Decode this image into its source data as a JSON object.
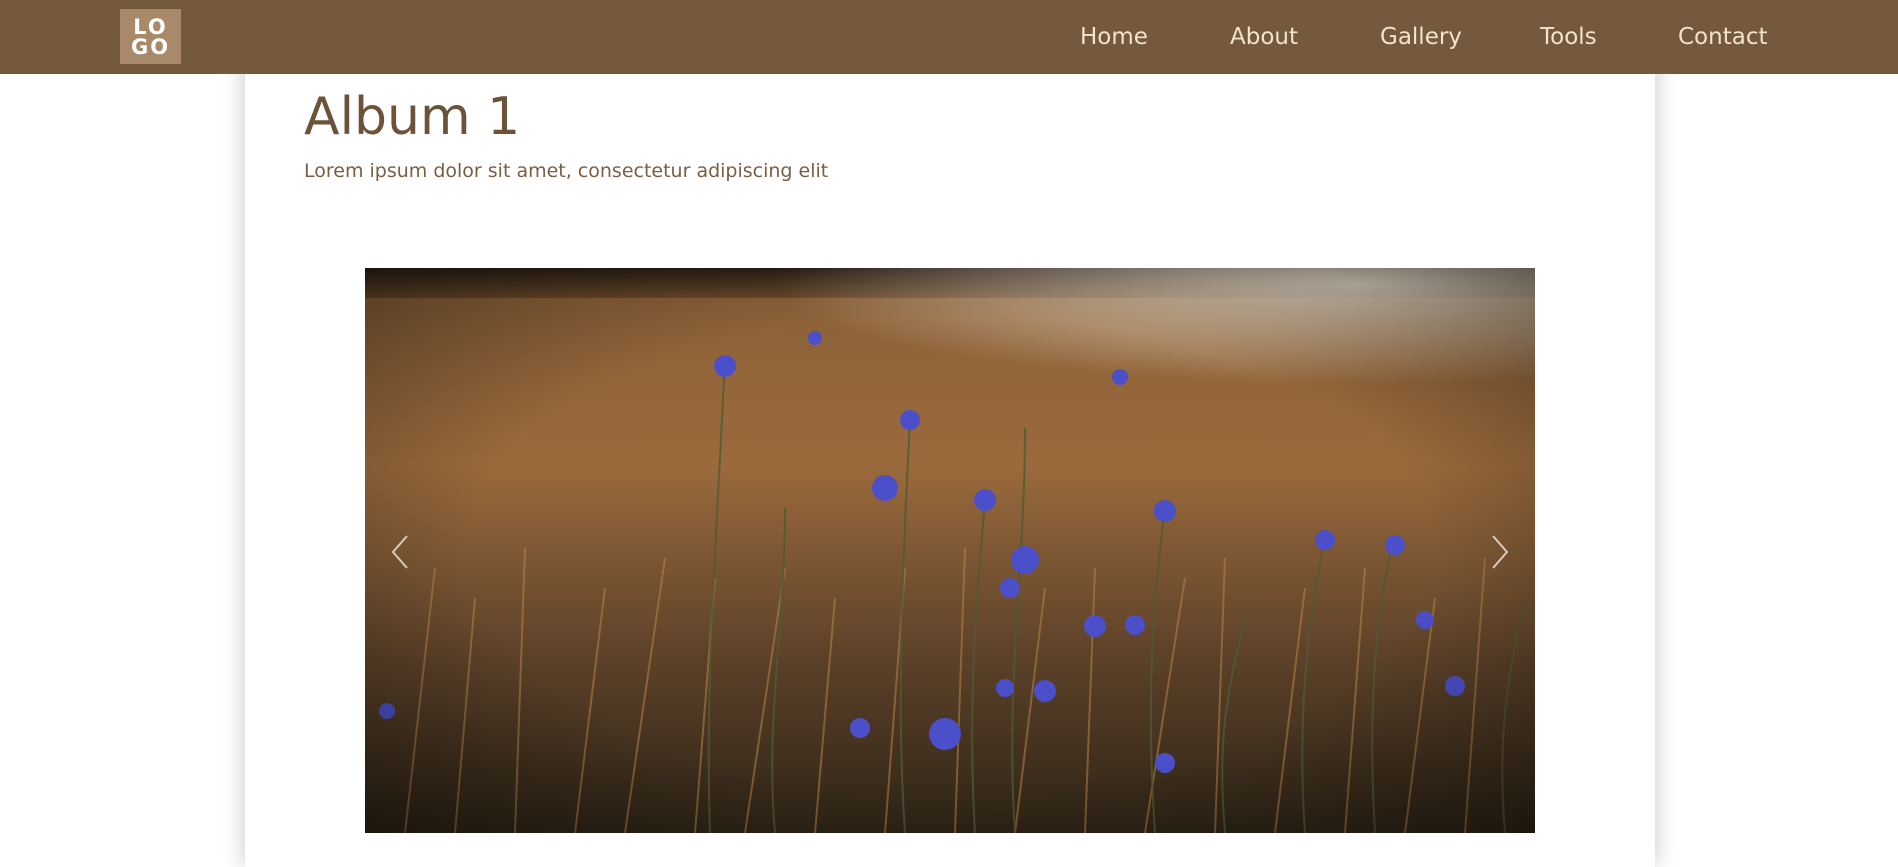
{
  "header": {
    "logo_line1": "LO",
    "logo_line2": "GO",
    "nav": [
      {
        "label": "Home"
      },
      {
        "label": "About"
      },
      {
        "label": "Gallery"
      },
      {
        "label": "Tools"
      },
      {
        "label": "Contact"
      }
    ]
  },
  "main": {
    "title": "Album 1",
    "subtitle": "Lorem ipsum dolor sit amet, consectetur adipiscing elit"
  },
  "colors": {
    "nav_bg": "#74593D",
    "nav_text": "#F3E3C7",
    "logo_bg": "#A88A6A",
    "title": "#6B5238"
  },
  "icons": {
    "prev": "chevron-left-icon",
    "next": "chevron-right-icon"
  }
}
